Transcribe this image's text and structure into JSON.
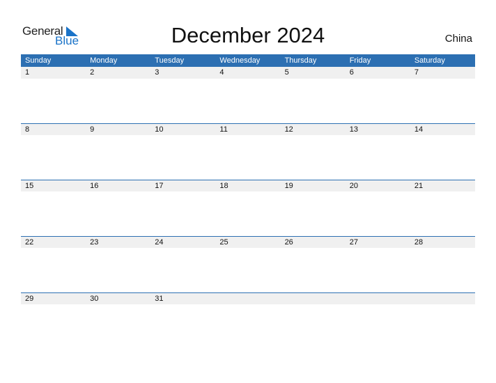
{
  "logo": {
    "part1": "General",
    "part2": "Blue"
  },
  "title": "December 2024",
  "country": "China",
  "days_of_week": [
    "Sunday",
    "Monday",
    "Tuesday",
    "Wednesday",
    "Thursday",
    "Friday",
    "Saturday"
  ],
  "weeks": [
    [
      "1",
      "2",
      "3",
      "4",
      "5",
      "6",
      "7"
    ],
    [
      "8",
      "9",
      "10",
      "11",
      "12",
      "13",
      "14"
    ],
    [
      "15",
      "16",
      "17",
      "18",
      "19",
      "20",
      "21"
    ],
    [
      "22",
      "23",
      "24",
      "25",
      "26",
      "27",
      "28"
    ],
    [
      "29",
      "30",
      "31",
      "",
      "",
      "",
      ""
    ]
  ],
  "colors": {
    "accent": "#2c6fb2",
    "row_bg": "#f0f0f0",
    "logo_blue": "#1a73c8"
  }
}
